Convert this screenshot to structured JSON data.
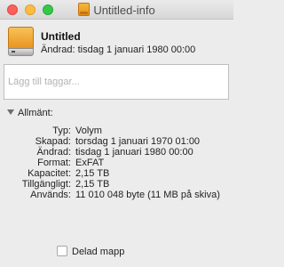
{
  "window": {
    "title": "Untitled-info"
  },
  "header": {
    "name": "Untitled",
    "modified": "Ändrad: tisdag 1 januari 1980 00:00"
  },
  "tags": {
    "placeholder": "Lägg till taggar..."
  },
  "general": {
    "heading": "Allmänt:",
    "rows": [
      {
        "key": "Typ:",
        "value": "Volym"
      },
      {
        "key": "Skapad:",
        "value": "torsdag 1 januari 1970 01:00"
      },
      {
        "key": "Ändrad:",
        "value": "tisdag 1 januari 1980 00:00"
      },
      {
        "key": "Format:",
        "value": "ExFAT"
      },
      {
        "key": "Kapacitet:",
        "value": "2,15 TB"
      },
      {
        "key": "Tillgängligt:",
        "value": "2,15 TB"
      },
      {
        "key": "Används:",
        "value": "11 010 048 byte (11 MB på skiva)"
      }
    ]
  },
  "shared_folder": {
    "label": "Delad mapp",
    "checked": false
  },
  "colors": {
    "drive_orange": "#e8921d",
    "close": "#fc605c",
    "minimize": "#fdbc40",
    "maximize": "#34c84a"
  }
}
